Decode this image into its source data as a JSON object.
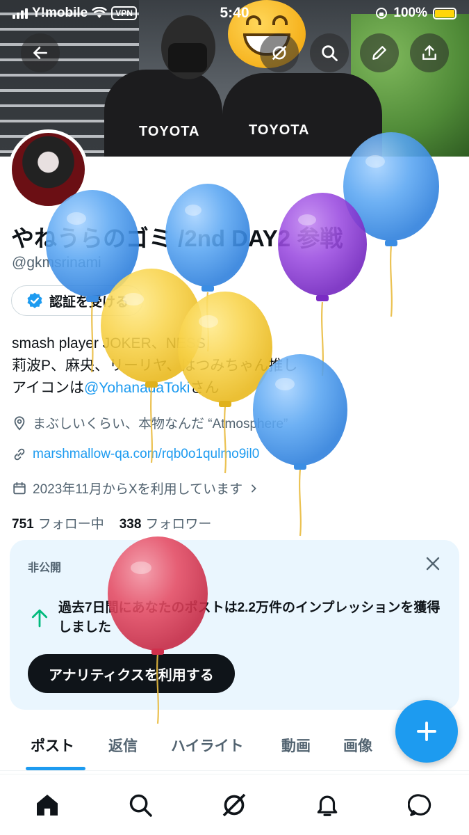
{
  "status_bar": {
    "carrier": "Y!mobile",
    "vpn": "VPN",
    "time": "5:40",
    "battery": "100%",
    "battery_color": "#ffd60a"
  },
  "header_buttons": [
    "back-arrow-icon",
    "grok-icon",
    "search-icon",
    "edit-icon",
    "share-icon"
  ],
  "banner": {
    "shirt_text_1": "TOYOTA",
    "shirt_text_2": "TOYOTA"
  },
  "profile": {
    "name": "やねうらのゴミ /2nd DAY2 参戦",
    "handle": "@gkmsrinami",
    "verify_label": "認証を受ける",
    "bio_line1": "smash player JOKER、NESS",
    "bio_line2": "莉波P、麻央、リーリヤ、はつみちゃん推し",
    "bio_line3_prefix": "アイコンは",
    "bio_line3_mention": "@YohanadaToki",
    "bio_line3_suffix": "さん",
    "location": "まぶしいくらい、本物なんだ “Atmosphere”",
    "link": "marshmallow-qa.com/rqb0o1qulmo9il0",
    "joined": "2023年11月からXを利用しています",
    "following_count": "751",
    "following_label": "フォロー中",
    "followers_count": "338",
    "followers_label": "フォロワー"
  },
  "private_card": {
    "tag": "非公開",
    "message": "過去7日間にあなたのポストは2.2万件のインプレッションを獲得しました",
    "cta": "アナリティクスを利用する"
  },
  "tabs": [
    "ポスト",
    "返信",
    "ハイライト",
    "動画",
    "画像"
  ],
  "active_tab": "ポスト",
  "colors": {
    "accent": "#1d9bf0",
    "text": "#0f1419",
    "muted": "#536471",
    "card_bg": "#eaf6fe"
  },
  "bottom_nav": [
    "home-icon",
    "search-icon",
    "grok-icon",
    "notifications-icon",
    "messages-icon"
  ]
}
